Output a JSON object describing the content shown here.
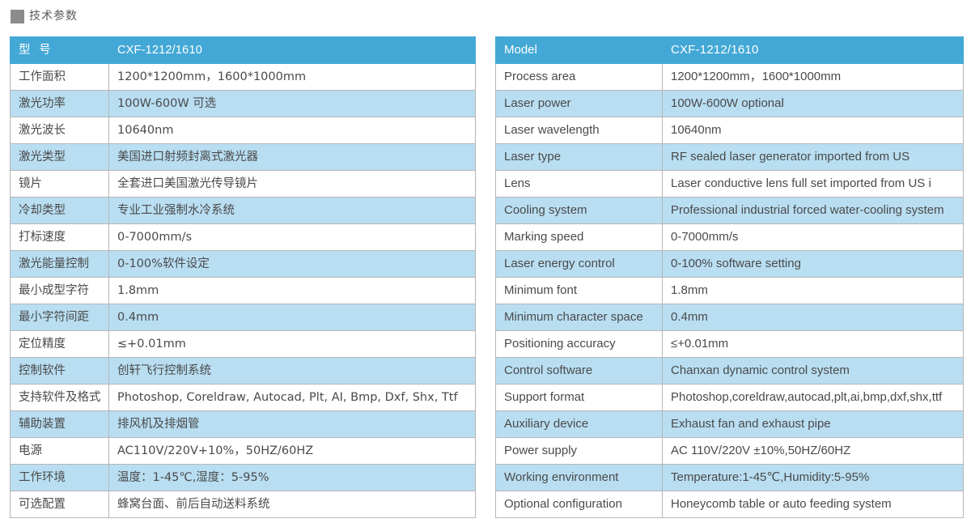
{
  "page": {
    "title": "技术参数",
    "bullet_color": "#8c8c8c",
    "header_color": "#43a8d5",
    "row_alt_color": "#b9def2",
    "border_color": "#b6b6b6",
    "text_color": "#4a4a4a"
  },
  "table_cn": {
    "header": {
      "label": "型 号",
      "value": "CXF-1212/1610"
    },
    "rows": [
      {
        "label": "工作面积",
        "value": "1200*1200mm，1600*1000mm"
      },
      {
        "label": "激光功率",
        "value": "100W-600W 可选"
      },
      {
        "label": "激光波长",
        "value": "10640nm"
      },
      {
        "label": "激光类型",
        "value": "美国进口射频封离式激光器"
      },
      {
        "label": "镜片",
        "value": "全套进口美国激光传导镜片"
      },
      {
        "label": "冷却类型",
        "value": "专业工业强制水冷系统"
      },
      {
        "label": "打标速度",
        "value": "0-7000mm/s"
      },
      {
        "label": "激光能量控制",
        "value": "0-100%软件设定"
      },
      {
        "label": "最小成型字符",
        "value": "1.8mm"
      },
      {
        "label": "最小字符间距",
        "value": "0.4mm"
      },
      {
        "label": "定位精度",
        "value": "≤+0.01mm"
      },
      {
        "label": "控制软件",
        "value": "创轩飞行控制系统"
      },
      {
        "label": "支持软件及格式",
        "value": "Photoshop, Coreldraw, Autocad, Plt, AI, Bmp, Dxf, Shx, Ttf"
      },
      {
        "label": "辅助装置",
        "value": "排风机及排烟管"
      },
      {
        "label": "电源",
        "value": "AC110V/220V+10%，50HZ/60HZ"
      },
      {
        "label": "工作环境",
        "value": "温度：1-45℃,湿度：5-95%"
      },
      {
        "label": "可选配置",
        "value": "蜂窝台面、前后自动送料系统"
      }
    ]
  },
  "table_en": {
    "header": {
      "label": "Model",
      "value": "CXF-1212/1610"
    },
    "rows": [
      {
        "label": "Process area",
        "value": "1200*1200mm，1600*1000mm"
      },
      {
        "label": "Laser power",
        "value": "100W-600W optional"
      },
      {
        "label": "Laser wavelength",
        "value": "10640nm"
      },
      {
        "label": "Laser type",
        "value": "RF sealed laser generator imported from US"
      },
      {
        "label": "Lens",
        "value": "Laser conductive lens full set imported from US i"
      },
      {
        "label": "Cooling system",
        "value": "Professional industrial forced water-cooling system"
      },
      {
        "label": "Marking speed",
        "value": "0-7000mm/s"
      },
      {
        "label": "Laser energy control",
        "value": "0-100% software setting"
      },
      {
        "label": "Minimum  font",
        "value": "1.8mm"
      },
      {
        "label": "Minimum character space",
        "value": "0.4mm"
      },
      {
        "label": "Positioning accuracy",
        "value": "≤+0.01mm"
      },
      {
        "label": "Control software",
        "value": "Chanxan dynamic control system"
      },
      {
        "label": "Support format",
        "value": "Photoshop,coreldraw,autocad,plt,ai,bmp,dxf,shx,ttf"
      },
      {
        "label": "Auxiliary device",
        "value": "Exhaust fan and exhaust pipe"
      },
      {
        "label": "Power supply",
        "value": "AC 110V/220V ±10%,50HZ/60HZ"
      },
      {
        "label": "Working environment",
        "value": "Temperature:1-45℃,Humidity:5-95%"
      },
      {
        "label": "Optional configuration",
        "value": "Honeycomb table or auto feeding system"
      }
    ]
  }
}
